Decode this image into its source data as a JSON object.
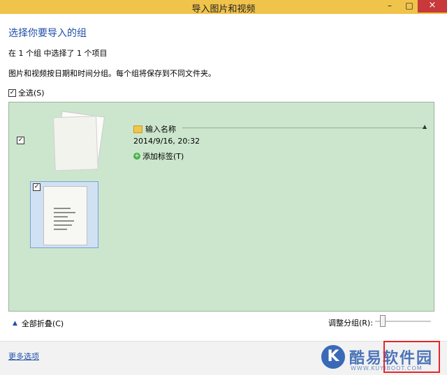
{
  "window": {
    "title": "导入图片和视频",
    "controls": {
      "minimize": "–",
      "maximize": "□",
      "close": "×"
    }
  },
  "heading": "选择你要导入的组",
  "summary": "在 1 个组 中选择了 1 个项目",
  "info": "图片和视频按日期和时间分组。每个组将保存到不同文件夹。",
  "select_all": {
    "label": "全选(S)",
    "checked": true,
    "mark": "✓"
  },
  "group": {
    "checked": true,
    "checkbox_mark": "✓",
    "folder_name": "输入名称",
    "collapse_arrow": "▲",
    "datetime": "2014/9/16, 20:32",
    "add_tag": {
      "icon": "+",
      "label": "添加标签(T)"
    },
    "photo": {
      "checked": true,
      "checkbox_mark": "✓"
    },
    "background_color": "#cce6cd"
  },
  "bottom": {
    "collapse_all_arrow": "▲",
    "collapse_all": "全部折叠(C)",
    "adjust_label": "调整分组(R):",
    "slider_value": 0.1
  },
  "footer": {
    "more_options": "更多选项"
  },
  "watermark": {
    "logo": "K",
    "text": "酷易软件园",
    "url": "WWW.KUYIBOOT.COM"
  },
  "colors": {
    "titlebar": "#f0c34b",
    "close": "#c7393a",
    "accent": "#1f4fa8",
    "highlight": "#e5262c"
  }
}
